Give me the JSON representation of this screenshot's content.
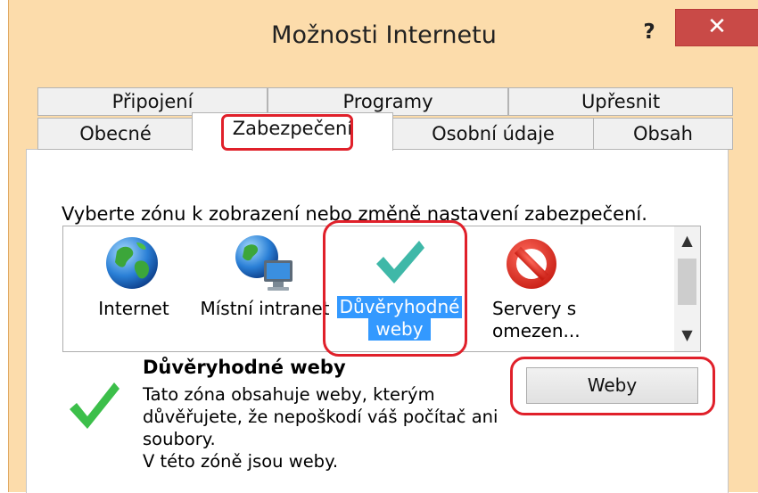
{
  "window": {
    "title": "Možnosti Internetu",
    "help_label": "?",
    "close_label": "✕"
  },
  "tabs": {
    "row1": [
      {
        "label": "Připojení"
      },
      {
        "label": "Programy"
      },
      {
        "label": "Upřesnit"
      }
    ],
    "row2": [
      {
        "label": "Obecné"
      },
      {
        "label": "Zabezpečení",
        "active": true
      },
      {
        "label": "Osobní údaje"
      },
      {
        "label": "Obsah"
      }
    ]
  },
  "security": {
    "prompt": "Vyberte zónu k zobrazení nebo změně nastavení zabezpečení.",
    "zones": [
      {
        "label": "Internet",
        "icon": "globe-icon"
      },
      {
        "label": "Místní intranet",
        "icon": "globe-computer-icon"
      },
      {
        "label_line1": "Důvěryhodné",
        "label_line2": "weby",
        "icon": "checkmark-icon",
        "selected": true
      },
      {
        "label_line1": "Servery s",
        "label_line2": "omezen...",
        "icon": "restricted-icon"
      }
    ],
    "selected_zone": {
      "title": "Důvěryhodné weby",
      "description_lines": [
        "Tato zóna obsahuje weby, kterým",
        "důvěřujete, že nepoškodí váš počítač ani",
        "soubory.",
        "V této zóně jsou weby."
      ],
      "icon": "checkmark-icon"
    },
    "sites_button_label": "Weby"
  },
  "colors": {
    "accent_selection": "#3399ff",
    "close_button": "#c94a47",
    "annotation_red": "#e0202a",
    "checkmark_teal": "#3fb8a8"
  }
}
